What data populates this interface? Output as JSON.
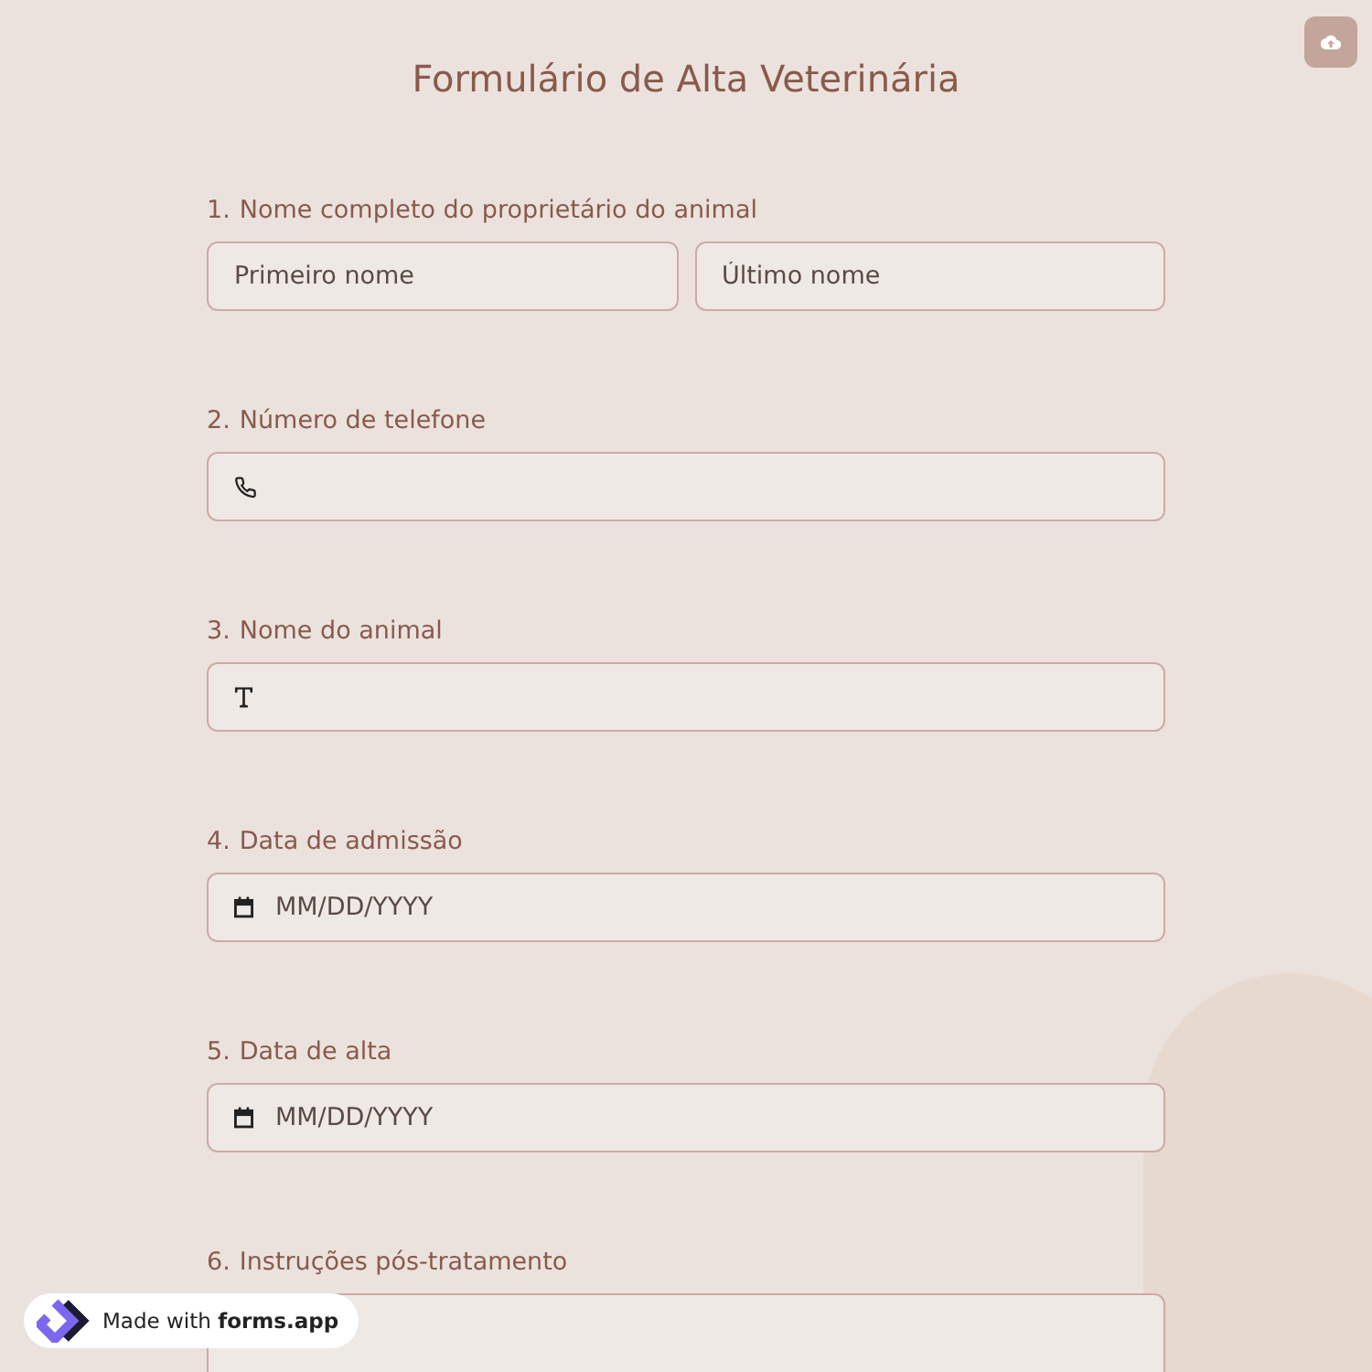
{
  "title": "Formulário de Alta Veterinária",
  "questions": [
    {
      "number": "1.",
      "label": "Nome completo do proprietário do animal",
      "kind": "name",
      "placeholders": [
        "Primeiro nome",
        "Último nome"
      ]
    },
    {
      "number": "2.",
      "label": "Número de telefone",
      "kind": "phone"
    },
    {
      "number": "3.",
      "label": "Nome do animal",
      "kind": "text"
    },
    {
      "number": "4.",
      "label": "Data de admissão",
      "kind": "date",
      "placeholder": "MM/DD/YYYY"
    },
    {
      "number": "5.",
      "label": "Data de alta",
      "kind": "date",
      "placeholder": "MM/DD/YYYY"
    },
    {
      "number": "6.",
      "label": "Instruções pós-tratamento",
      "kind": "textarea"
    }
  ],
  "badge": "Made with **forms.app**"
}
